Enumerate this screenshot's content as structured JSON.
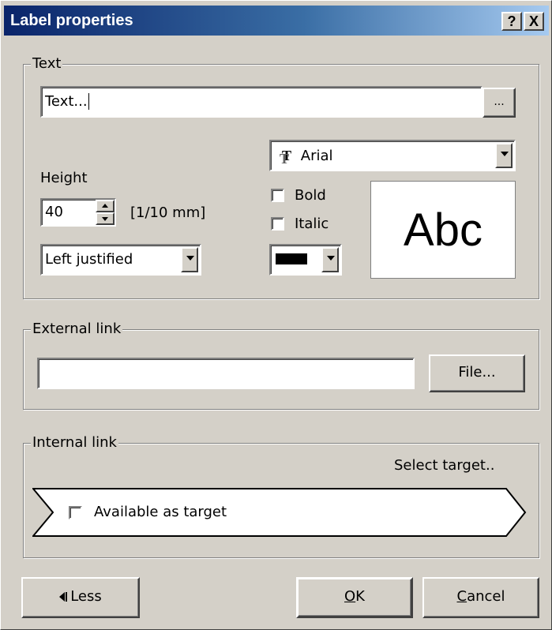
{
  "window": {
    "title": "Label properties",
    "help_label": "?",
    "close_label": "X"
  },
  "text_group": {
    "legend": "Text",
    "text_value": "Text...",
    "browse_label": "...",
    "font": {
      "name": "Arial",
      "icon": "truetype-font-icon"
    },
    "height_label": "Height",
    "height_value": "40",
    "height_unit": "[1/10 mm]",
    "justification": "Left justified",
    "bold_label": "Bold",
    "bold_checked": false,
    "italic_label": "Italic",
    "italic_checked": false,
    "color": "#000000",
    "preview_text": "Abc"
  },
  "external_link": {
    "legend": "External link",
    "value": "",
    "file_button": "File..."
  },
  "internal_link": {
    "legend": "Internal link",
    "select_target": "Select target..",
    "available_label": "Available as target",
    "available_checked": false
  },
  "buttons": {
    "less": "Less",
    "ok_underline": "O",
    "ok_rest": "K",
    "cancel_underline": "C",
    "cancel_rest": "ancel"
  }
}
